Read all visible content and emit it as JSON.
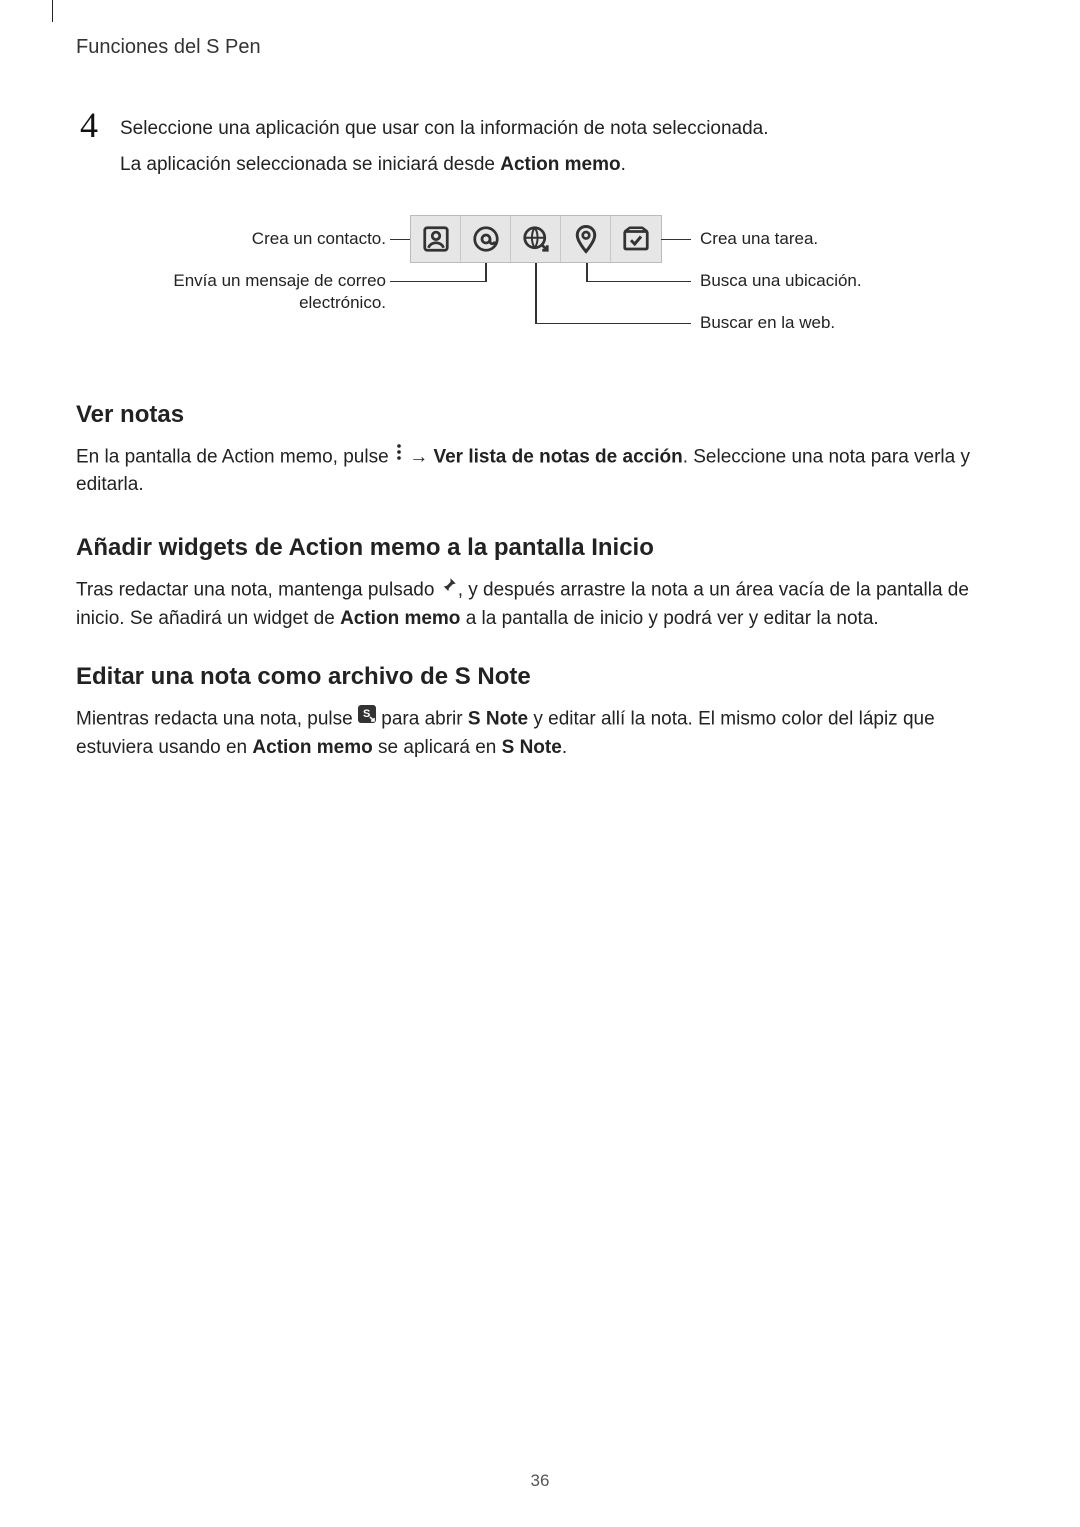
{
  "header": {
    "section": "Funciones del S Pen"
  },
  "step": {
    "number": "4",
    "text": "Seleccione una aplicación que usar con la información de nota seleccionada.",
    "sub_pre": "La aplicación seleccionada se iniciará desde ",
    "sub_bold": "Action memo",
    "sub_post": "."
  },
  "diagram": {
    "left1": "Crea un contacto.",
    "left2_a": "Envía un mensaje de correo",
    "left2_b": "electrónico.",
    "right1": "Crea una tarea.",
    "right2": "Busca una ubicación.",
    "right3": "Buscar en la web."
  },
  "vernotas": {
    "heading": "Ver notas",
    "p1_a": "En la pantalla de Action memo, pulse ",
    "p1_b": " → ",
    "p1_bold": "Ver lista de notas de acción",
    "p1_c": ". Seleccione una nota para verla y editarla."
  },
  "anadir": {
    "heading": "Añadir widgets de Action memo a la pantalla Inicio",
    "p1_a": "Tras redactar una nota, mantenga pulsado ",
    "p1_b": ", y después arrastre la nota a un área vacía de la pantalla de inicio. Se añadirá un widget de ",
    "p1_bold": "Action memo",
    "p1_c": " a la pantalla de inicio y podrá ver y editar la nota."
  },
  "editar": {
    "heading": "Editar una nota como archivo de S Note",
    "p1_a": "Mientras redacta una nota, pulse ",
    "p1_b": " para abrir ",
    "p1_bold1": "S Note",
    "p1_c": " y editar allí la nota. El mismo color del lápiz que estuviera usando en ",
    "p1_bold2": "Action memo",
    "p1_d": " se aplicará en ",
    "p1_bold3": "S Note",
    "p1_e": "."
  },
  "page_number": "36"
}
